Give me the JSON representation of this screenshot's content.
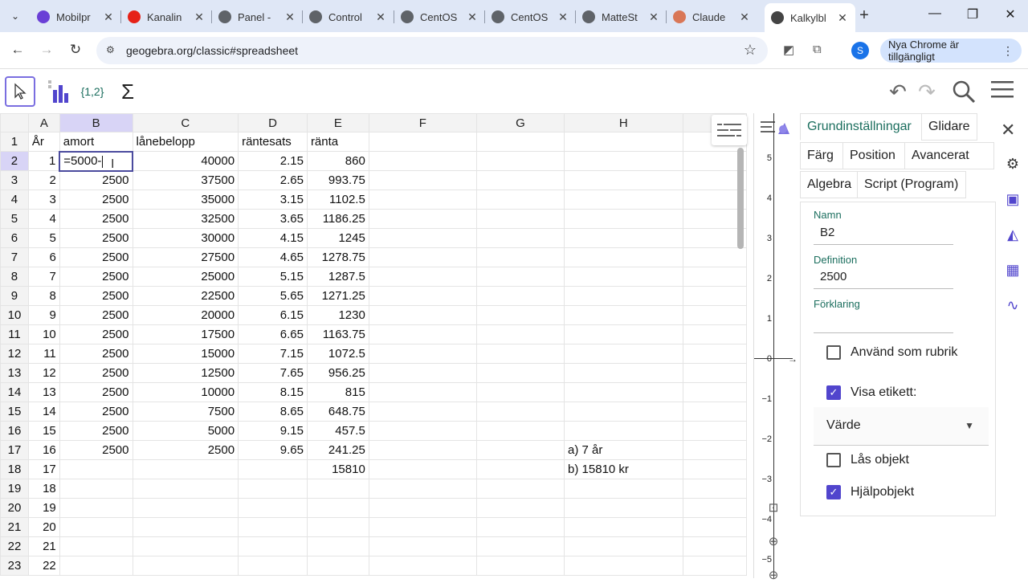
{
  "browser": {
    "tabs": [
      {
        "label": "Mobilpr",
        "icon": "mobil-favicon",
        "color": "#6a3fd6"
      },
      {
        "label": "Kanalin",
        "icon": "youtube-favicon",
        "color": "#e62117"
      },
      {
        "label": "Panel -",
        "icon": "globe-favicon",
        "color": "#5f6368"
      },
      {
        "label": "Control",
        "icon": "globe-favicon",
        "color": "#5f6368"
      },
      {
        "label": "CentOS",
        "icon": "globe-favicon",
        "color": "#5f6368"
      },
      {
        "label": "CentOS",
        "icon": "globe-favicon",
        "color": "#5f6368"
      },
      {
        "label": "MatteSt",
        "icon": "globe-favicon",
        "color": "#5f6368"
      },
      {
        "label": "Claude",
        "icon": "claude-favicon",
        "color": "#d97757"
      },
      {
        "label": "Kalkylbl",
        "icon": "geogebra-favicon",
        "color": "#444444"
      }
    ],
    "url": "geogebra.org/classic#spreadsheet",
    "profile_initial": "S",
    "update_label": "Nya Chrome är tillgängligt"
  },
  "spreadsheet": {
    "columns": [
      "A",
      "B",
      "C",
      "D",
      "E",
      "F",
      "G",
      "H"
    ],
    "rows": [
      {
        "n": "1",
        "cells": [
          "År",
          "amort",
          "lånebelopp",
          "räntesats",
          "ränta",
          "",
          "",
          ""
        ]
      },
      {
        "n": "2",
        "cells": [
          "1",
          "=5000-",
          "40000",
          "2.15",
          "860",
          "",
          "",
          ""
        ]
      },
      {
        "n": "3",
        "cells": [
          "2",
          "2500",
          "37500",
          "2.65",
          "993.75",
          "",
          "",
          ""
        ]
      },
      {
        "n": "4",
        "cells": [
          "3",
          "2500",
          "35000",
          "3.15",
          "1102.5",
          "",
          "",
          ""
        ]
      },
      {
        "n": "5",
        "cells": [
          "4",
          "2500",
          "32500",
          "3.65",
          "1186.25",
          "",
          "",
          ""
        ]
      },
      {
        "n": "6",
        "cells": [
          "5",
          "2500",
          "30000",
          "4.15",
          "1245",
          "",
          "",
          ""
        ]
      },
      {
        "n": "7",
        "cells": [
          "6",
          "2500",
          "27500",
          "4.65",
          "1278.75",
          "",
          "",
          ""
        ]
      },
      {
        "n": "8",
        "cells": [
          "7",
          "2500",
          "25000",
          "5.15",
          "1287.5",
          "",
          "",
          ""
        ]
      },
      {
        "n": "9",
        "cells": [
          "8",
          "2500",
          "22500",
          "5.65",
          "1271.25",
          "",
          "",
          ""
        ]
      },
      {
        "n": "10",
        "cells": [
          "9",
          "2500",
          "20000",
          "6.15",
          "1230",
          "",
          "",
          ""
        ]
      },
      {
        "n": "11",
        "cells": [
          "10",
          "2500",
          "17500",
          "6.65",
          "1163.75",
          "",
          "",
          ""
        ]
      },
      {
        "n": "12",
        "cells": [
          "11",
          "2500",
          "15000",
          "7.15",
          "1072.5",
          "",
          "",
          ""
        ]
      },
      {
        "n": "13",
        "cells": [
          "12",
          "2500",
          "12500",
          "7.65",
          "956.25",
          "",
          "",
          ""
        ]
      },
      {
        "n": "14",
        "cells": [
          "13",
          "2500",
          "10000",
          "8.15",
          "815",
          "",
          "",
          ""
        ]
      },
      {
        "n": "15",
        "cells": [
          "14",
          "2500",
          "7500",
          "8.65",
          "648.75",
          "",
          "",
          ""
        ]
      },
      {
        "n": "16",
        "cells": [
          "15",
          "2500",
          "5000",
          "9.15",
          "457.5",
          "",
          "",
          ""
        ]
      },
      {
        "n": "17",
        "cells": [
          "16",
          "2500",
          "2500",
          "9.65",
          "241.25",
          "",
          "",
          "a) 7 år"
        ]
      },
      {
        "n": "18",
        "cells": [
          "17",
          "",
          "",
          "",
          "15810",
          "",
          "",
          "b) 15810 kr"
        ]
      },
      {
        "n": "19",
        "cells": [
          "18",
          "",
          "",
          "",
          "",
          "",
          "",
          ""
        ]
      },
      {
        "n": "20",
        "cells": [
          "19",
          "",
          "",
          "",
          "",
          "",
          "",
          ""
        ]
      },
      {
        "n": "21",
        "cells": [
          "20",
          "",
          "",
          "",
          "",
          "",
          "",
          ""
        ]
      },
      {
        "n": "22",
        "cells": [
          "21",
          "",
          "",
          "",
          "",
          "",
          "",
          ""
        ]
      },
      {
        "n": "23",
        "cells": [
          "22",
          "",
          "",
          "",
          "",
          "",
          "",
          ""
        ]
      }
    ],
    "editing_cell": "B2"
  },
  "toolbar": {
    "list_tool_label": "{1,2}",
    "sum_tool_label": "Σ"
  },
  "graphics": {
    "ticks": [
      "5",
      "4",
      "3",
      "2",
      "1",
      "0",
      "−1",
      "−2",
      "−3",
      "−4",
      "−5"
    ]
  },
  "properties": {
    "tabs": [
      "Grundinställningar",
      "Glidare",
      "Färg",
      "Position",
      "Avancerat",
      "Algebra",
      "Script (Program)"
    ],
    "active_tab": "Grundinställningar",
    "name_label": "Namn",
    "name_value": "B2",
    "definition_label": "Definition",
    "definition_value": "2500",
    "caption_label": "Förklaring",
    "caption_value": "",
    "use_as_caption_label": "Använd som rubrik",
    "show_label_label": "Visa etikett:",
    "label_mode": "Värde",
    "lock_label": "Lås objekt",
    "auxiliary_label": "Hjälpobjekt",
    "checkboxes": {
      "use_as_caption": false,
      "show_label": true,
      "lock": false,
      "auxiliary": true
    }
  },
  "colors": {
    "accent": "#5145cd",
    "geogebra_green": "#1b6e5e",
    "selected_col": "#d8d4f6"
  }
}
